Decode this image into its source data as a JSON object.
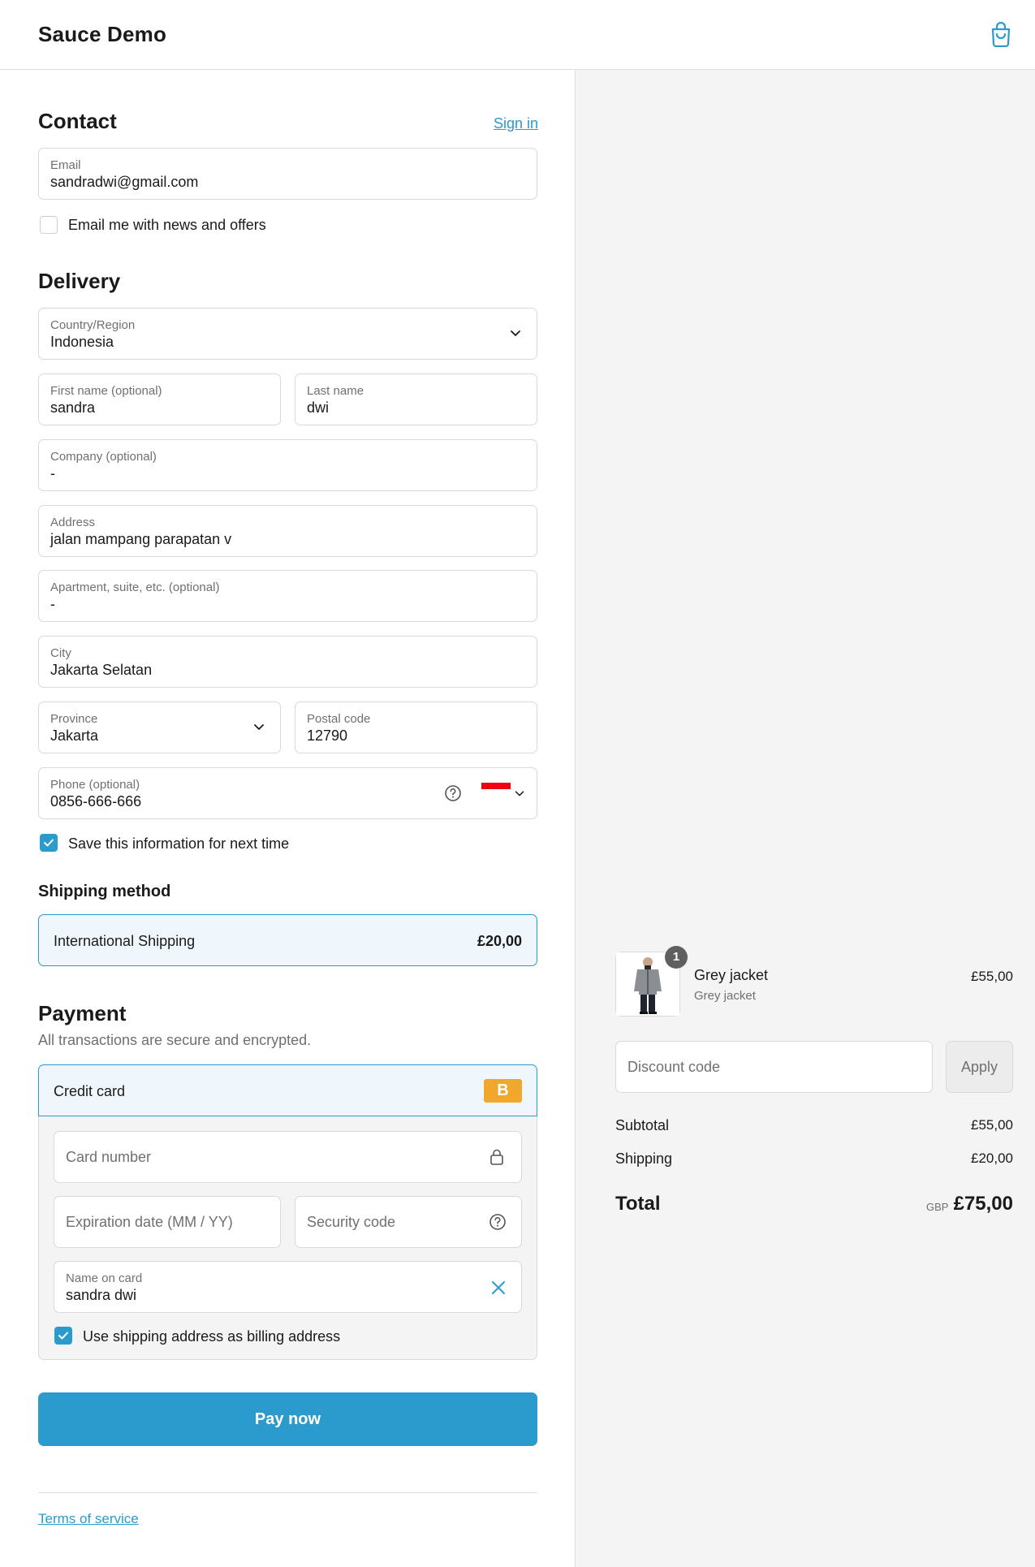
{
  "header": {
    "brand": "Sauce Demo",
    "cart_icon": "shopping-bag-icon"
  },
  "contact": {
    "heading": "Contact",
    "sign_in": "Sign in",
    "email_label": "Email",
    "email_value": "sandradwi@gmail.com",
    "news_label": "Email me with news and offers",
    "news_checked": false
  },
  "delivery": {
    "heading": "Delivery",
    "country_label": "Country/Region",
    "country_value": "Indonesia",
    "first_name_label": "First name (optional)",
    "first_name_value": "sandra",
    "last_name_label": "Last name",
    "last_name_value": "dwi",
    "company_label": "Company (optional)",
    "company_value": "-",
    "address_label": "Address",
    "address_value": "jalan mampang parapatan v",
    "apartment_label": "Apartment, suite, etc. (optional)",
    "apartment_value": "-",
    "city_label": "City",
    "city_value": "Jakarta Selatan",
    "province_label": "Province",
    "province_value": "Jakarta",
    "postal_label": "Postal code",
    "postal_value": "12790",
    "phone_label": "Phone (optional)",
    "phone_value": "0856-666-666",
    "save_label": "Save this information for next time",
    "save_checked": true
  },
  "shipping": {
    "heading": "Shipping method",
    "option_name": "International Shipping",
    "option_price": "£20,00"
  },
  "payment": {
    "heading": "Payment",
    "subtitle": "All transactions are secure and encrypted.",
    "method": "Credit card",
    "badge": "B",
    "card_number_placeholder": "Card number",
    "expiry_placeholder": "Expiration date (MM / YY)",
    "security_placeholder": "Security code",
    "name_label": "Name on card",
    "name_value": "sandra dwi",
    "billing_label": "Use shipping address as billing address",
    "billing_checked": true,
    "pay_button": "Pay now"
  },
  "footer": {
    "terms": "Terms of service"
  },
  "summary": {
    "item_name": "Grey jacket",
    "item_variant": "Grey jacket",
    "item_price": "£55,00",
    "item_quantity": "1",
    "discount_placeholder": "Discount code",
    "apply": "Apply",
    "subtotal_label": "Subtotal",
    "subtotal_value": "£55,00",
    "shipping_label": "Shipping",
    "shipping_value": "£20,00",
    "total_label": "Total",
    "currency": "GBP",
    "total_value": "£75,00"
  },
  "colors": {
    "accent": "#2a9bcc",
    "badge": "#f0a82c",
    "summary_bg": "#f4f4f4"
  }
}
